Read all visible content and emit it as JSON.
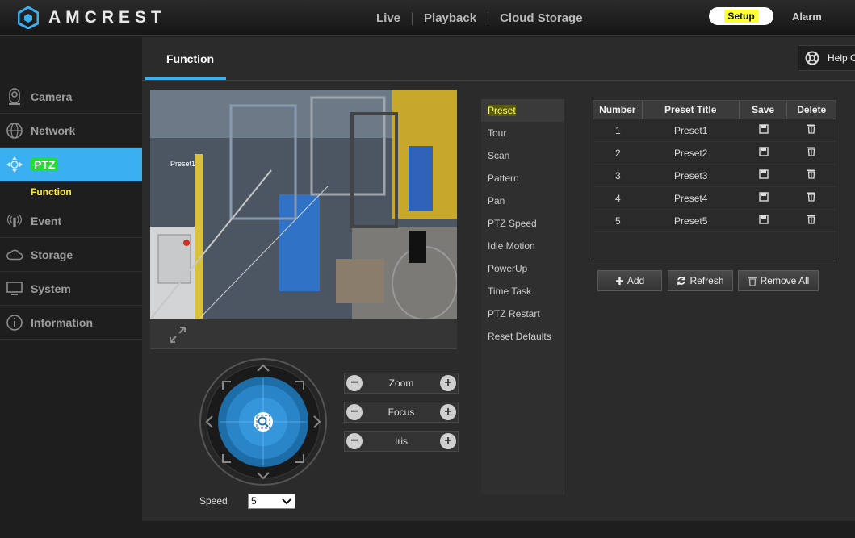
{
  "brand": {
    "name": "AMCREST"
  },
  "topnav": {
    "items": [
      {
        "label": "Live"
      },
      {
        "label": "Playback"
      },
      {
        "label": "Cloud Storage"
      }
    ],
    "setup_label": "Setup",
    "alarm_label": "Alarm"
  },
  "sidebar": {
    "items": [
      {
        "label": "Camera",
        "icon": "camera-icon"
      },
      {
        "label": "Network",
        "icon": "globe-icon"
      },
      {
        "label": "PTZ",
        "icon": "ptz-icon"
      },
      {
        "label": "Event",
        "icon": "event-icon"
      },
      {
        "label": "Storage",
        "icon": "cloud-icon"
      },
      {
        "label": "System",
        "icon": "monitor-icon"
      },
      {
        "label": "Information",
        "icon": "info-icon"
      }
    ],
    "sub_item": "Function"
  },
  "tabs": {
    "active": "Function"
  },
  "help": {
    "label": "Help C"
  },
  "ptz_controls": {
    "zoom": "Zoom",
    "focus": "Focus",
    "iris": "Iris",
    "speed_label": "Speed",
    "speed_value": "5"
  },
  "menu": {
    "items": [
      "Preset",
      "Tour",
      "Scan",
      "Pattern",
      "Pan",
      "PTZ Speed",
      "Idle Motion",
      "PowerUp",
      "Time Task",
      "PTZ Restart",
      "Reset Defaults"
    ]
  },
  "preset_table": {
    "columns": [
      "Number",
      "Preset Title",
      "Save",
      "Delete"
    ],
    "rows": [
      {
        "number": "1",
        "title": "Preset1"
      },
      {
        "number": "2",
        "title": "Preset2"
      },
      {
        "number": "3",
        "title": "Preset3"
      },
      {
        "number": "4",
        "title": "Preset4"
      },
      {
        "number": "5",
        "title": "Preset5"
      }
    ]
  },
  "buttons": {
    "add": "Add",
    "refresh": "Refresh",
    "remove_all": "Remove All"
  },
  "video": {
    "overlay_label": "Preset1"
  },
  "colors": {
    "accent": "#3bb0f0",
    "highlight": "#ffff33",
    "ptz_highlight": "#22dd33"
  }
}
